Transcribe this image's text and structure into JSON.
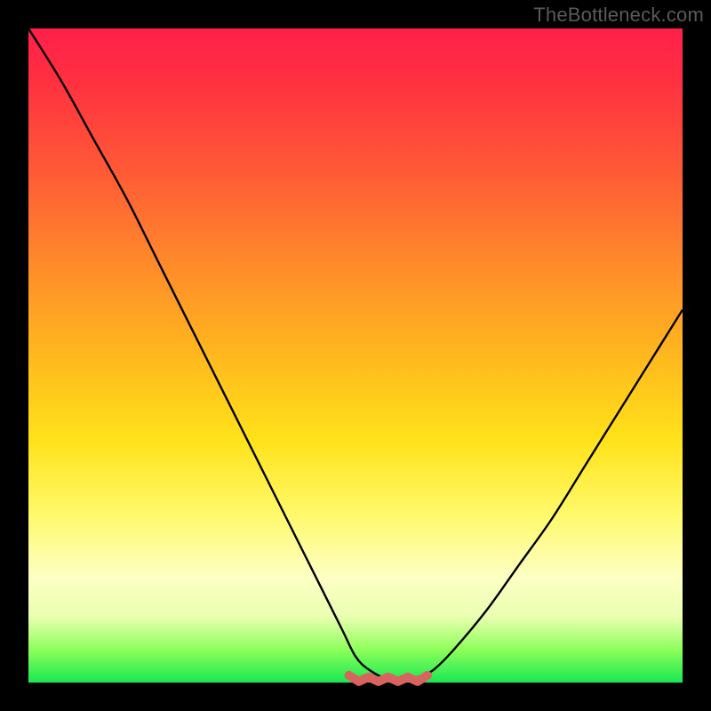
{
  "watermark": "TheBottleneck.com",
  "colors": {
    "frame": "#000000",
    "gradient_top": "#ff1f4b",
    "gradient_bottom": "#18e852",
    "curve": "#000000",
    "marker": "#d9635f"
  },
  "chart_data": {
    "type": "line",
    "title": "",
    "xlabel": "",
    "ylabel": "",
    "xlim": [
      0,
      100
    ],
    "ylim": [
      0,
      100
    ],
    "series": [
      {
        "name": "bottleneck-curve",
        "x": [
          0,
          5,
          10,
          15,
          20,
          25,
          30,
          35,
          40,
          45,
          48,
          50,
          52,
          55,
          58,
          60,
          62,
          65,
          70,
          75,
          80,
          85,
          90,
          95,
          100
        ],
        "y": [
          100,
          92,
          83,
          74,
          64,
          54,
          44,
          34,
          24,
          14,
          8,
          4,
          2,
          0.5,
          0.5,
          1,
          2,
          5,
          11,
          18,
          25,
          33,
          41,
          49,
          57
        ]
      }
    ],
    "annotations": [
      {
        "name": "optimal-band",
        "type": "marker-strip",
        "x_range": [
          49,
          61
        ],
        "y": 0.5
      }
    ]
  }
}
